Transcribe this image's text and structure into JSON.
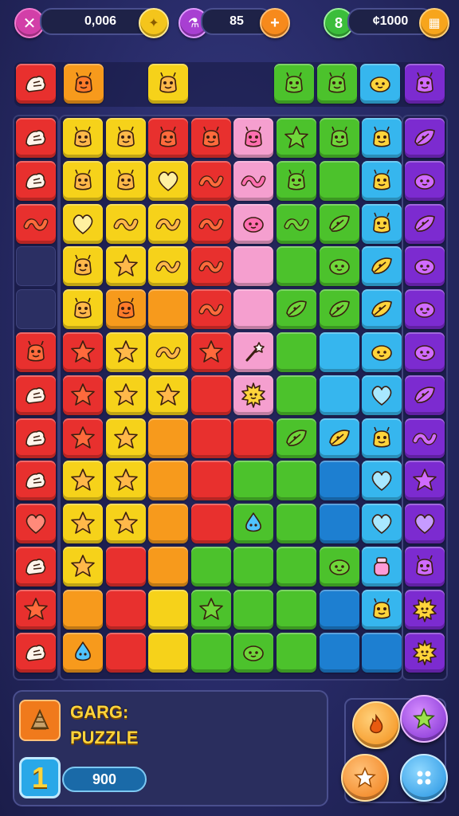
{
  "hud": {
    "coins_value": "0,006",
    "potions_value": "85",
    "level_value": "8",
    "gold_value": "¢1000"
  },
  "colors": {
    "red": "#e8302e",
    "orange": "#f79a1c",
    "yellow": "#f6d21a",
    "pink": "#f59fcf",
    "green": "#4cc22c",
    "cyan": "#36b6ee",
    "blue": "#1d7fd1",
    "purple": "#7c2bd0",
    "empty": "#2b2f63"
  },
  "top_rail": [
    {
      "col": 0,
      "color": "red",
      "icon": "hand-icon"
    },
    {
      "col": 1,
      "color": "orange",
      "icon": "creature-icon"
    },
    {
      "col": 3,
      "color": "yellow",
      "icon": "creature-icon"
    },
    {
      "col": 6,
      "color": "green",
      "icon": "creature-icon"
    },
    {
      "col": 7,
      "color": "green",
      "icon": "creature-icon"
    },
    {
      "col": 8,
      "color": "cyan",
      "icon": "blob-icon"
    },
    {
      "col": 9,
      "color": "purple",
      "icon": "creature-icon"
    }
  ],
  "left_column": [
    {
      "color": "red",
      "icon": "hand-icon"
    },
    {
      "color": "red",
      "icon": "hand-icon"
    },
    {
      "color": "red",
      "icon": "worm-icon"
    },
    {
      "color": "empty",
      "icon": ""
    },
    {
      "color": "empty",
      "icon": ""
    },
    {
      "color": "red",
      "icon": "creature-icon"
    },
    {
      "color": "red",
      "icon": "hand-icon"
    },
    {
      "color": "red",
      "icon": "hand-icon"
    },
    {
      "color": "red",
      "icon": "hand-icon"
    },
    {
      "color": "red",
      "icon": "heart-icon"
    },
    {
      "color": "red",
      "icon": "hand-icon"
    },
    {
      "color": "red",
      "icon": "star-icon"
    },
    {
      "color": "red",
      "icon": "hand-icon"
    }
  ],
  "right_column": [
    {
      "icon": "leaf-icon"
    },
    {
      "icon": "blob-icon"
    },
    {
      "icon": "leaf-icon"
    },
    {
      "icon": "blob-icon"
    },
    {
      "icon": "blob-icon"
    },
    {
      "icon": "blob-icon"
    },
    {
      "icon": "leaf-icon"
    },
    {
      "icon": "worm-icon"
    },
    {
      "icon": "star-icon"
    },
    {
      "icon": "heart-icon"
    },
    {
      "icon": "creature-icon"
    },
    {
      "icon": "sun-icon"
    },
    {
      "icon": "sun-icon"
    }
  ],
  "board": [
    [
      [
        "yellow",
        "creature-icon"
      ],
      [
        "yellow",
        "creature-icon"
      ],
      [
        "red",
        "creature-icon"
      ],
      [
        "red",
        "creature-icon"
      ],
      [
        "pink",
        "creature-icon"
      ],
      [
        "green",
        "star-icon"
      ],
      [
        "green",
        "creature-icon"
      ],
      [
        "cyan",
        "creature-icon"
      ]
    ],
    [
      [
        "yellow",
        "creature-icon"
      ],
      [
        "yellow",
        "creature-icon"
      ],
      [
        "yellow",
        "heart-icon"
      ],
      [
        "red",
        "worm-icon"
      ],
      [
        "pink",
        "worm-icon"
      ],
      [
        "green",
        "creature-icon"
      ],
      [
        "green",
        ""
      ],
      [
        "cyan",
        "creature-icon"
      ]
    ],
    [
      [
        "yellow",
        "heart-icon"
      ],
      [
        "yellow",
        "worm-icon"
      ],
      [
        "yellow",
        "worm-icon"
      ],
      [
        "red",
        "worm-icon"
      ],
      [
        "pink",
        "blob-icon"
      ],
      [
        "green",
        "worm-icon"
      ],
      [
        "green",
        "leaf-icon"
      ],
      [
        "cyan",
        "creature-icon"
      ]
    ],
    [
      [
        "yellow",
        "creature-icon"
      ],
      [
        "yellow",
        "star-icon"
      ],
      [
        "yellow",
        "worm-icon"
      ],
      [
        "red",
        "worm-icon"
      ],
      [
        "pink",
        ""
      ],
      [
        "green",
        ""
      ],
      [
        "green",
        "blob-icon"
      ],
      [
        "cyan",
        "leaf-icon"
      ]
    ],
    [
      [
        "yellow",
        "creature-icon"
      ],
      [
        "orange",
        "creature-icon"
      ],
      [
        "orange",
        ""
      ],
      [
        "red",
        "worm-icon"
      ],
      [
        "pink",
        ""
      ],
      [
        "green",
        "leaf-icon"
      ],
      [
        "green",
        "leaf-icon"
      ],
      [
        "cyan",
        "leaf-icon"
      ]
    ],
    [
      [
        "red",
        "star-icon"
      ],
      [
        "yellow",
        "star-icon"
      ],
      [
        "yellow",
        "worm-icon"
      ],
      [
        "red",
        "star-icon"
      ],
      [
        "pink",
        "wand-icon"
      ],
      [
        "green",
        ""
      ],
      [
        "cyan",
        ""
      ],
      [
        "cyan",
        "blob-icon"
      ]
    ],
    [
      [
        "red",
        "star-icon"
      ],
      [
        "yellow",
        "star-icon"
      ],
      [
        "yellow",
        "star-icon"
      ],
      [
        "red",
        ""
      ],
      [
        "pink",
        "sun-icon"
      ],
      [
        "green",
        ""
      ],
      [
        "cyan",
        ""
      ],
      [
        "cyan",
        "heart-icon"
      ]
    ],
    [
      [
        "red",
        "star-icon"
      ],
      [
        "yellow",
        "star-icon"
      ],
      [
        "orange",
        ""
      ],
      [
        "red",
        ""
      ],
      [
        "red",
        ""
      ],
      [
        "green",
        "leaf-icon"
      ],
      [
        "cyan",
        "leaf-icon"
      ],
      [
        "cyan",
        "creature-icon"
      ]
    ],
    [
      [
        "yellow",
        "star-icon"
      ],
      [
        "yellow",
        "star-icon"
      ],
      [
        "orange",
        ""
      ],
      [
        "red",
        ""
      ],
      [
        "green",
        ""
      ],
      [
        "green",
        ""
      ],
      [
        "blue",
        ""
      ],
      [
        "cyan",
        "heart-icon"
      ]
    ],
    [
      [
        "yellow",
        "star-icon"
      ],
      [
        "yellow",
        "star-icon"
      ],
      [
        "orange",
        ""
      ],
      [
        "red",
        ""
      ],
      [
        "green",
        "drop-icon"
      ],
      [
        "green",
        ""
      ],
      [
        "blue",
        ""
      ],
      [
        "cyan",
        "heart-icon"
      ]
    ],
    [
      [
        "yellow",
        "star-icon"
      ],
      [
        "red",
        ""
      ],
      [
        "orange",
        ""
      ],
      [
        "green",
        ""
      ],
      [
        "green",
        ""
      ],
      [
        "green",
        ""
      ],
      [
        "green",
        "blob-icon"
      ],
      [
        "cyan",
        "jar-icon"
      ]
    ],
    [
      [
        "orange",
        ""
      ],
      [
        "red",
        ""
      ],
      [
        "yellow",
        ""
      ],
      [
        "green",
        "star-icon"
      ],
      [
        "green",
        ""
      ],
      [
        "green",
        ""
      ],
      [
        "blue",
        ""
      ],
      [
        "cyan",
        "creature-icon"
      ]
    ],
    [
      [
        "orange",
        "drop-icon"
      ],
      [
        "red",
        ""
      ],
      [
        "yellow",
        ""
      ],
      [
        "green",
        ""
      ],
      [
        "green",
        "blob-icon"
      ],
      [
        "green",
        ""
      ],
      [
        "blue",
        ""
      ],
      [
        "blue",
        ""
      ]
    ]
  ],
  "panel": {
    "title": "GARG: PUZZLE",
    "level": "1",
    "score": "900"
  }
}
